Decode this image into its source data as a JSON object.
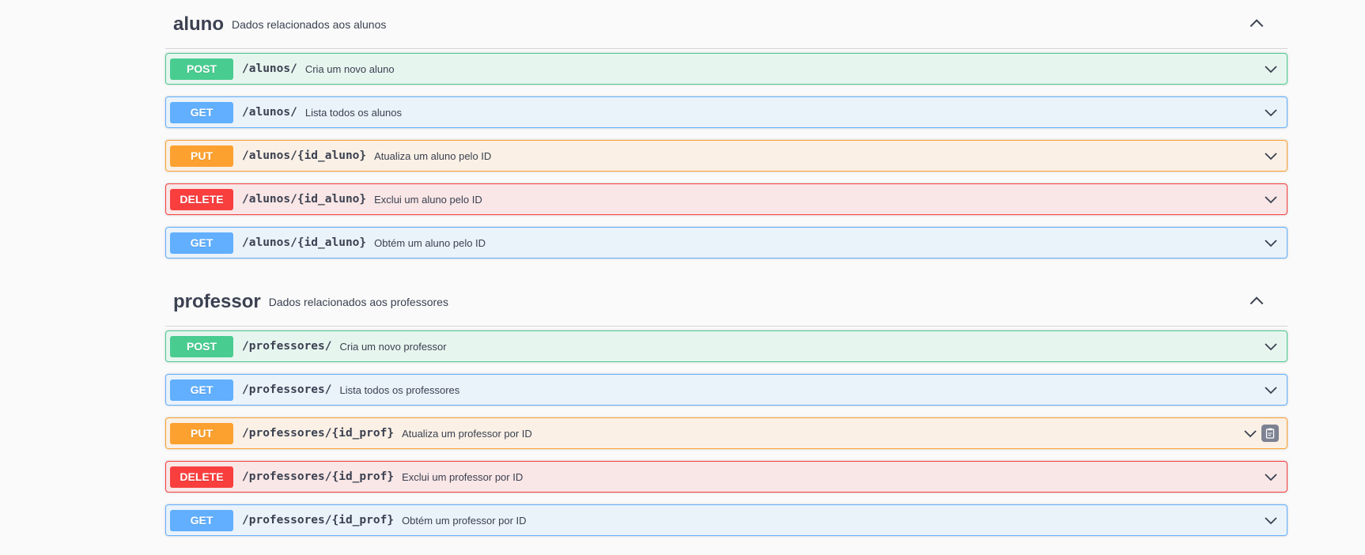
{
  "tags": [
    {
      "name": "aluno",
      "description": "Dados relacionados aos alunos",
      "chevron_icon": "chevron-up-icon",
      "operations": [
        {
          "method": "POST",
          "path": "/alunos/",
          "summary": "Cria um novo aluno"
        },
        {
          "method": "GET",
          "path": "/alunos/",
          "summary": "Lista todos os alunos"
        },
        {
          "method": "PUT",
          "path": "/alunos/{id_aluno}",
          "summary": "Atualiza um aluno pelo ID"
        },
        {
          "method": "DELETE",
          "path": "/alunos/{id_aluno}",
          "summary": "Exclui um aluno pelo ID"
        },
        {
          "method": "GET",
          "path": "/alunos/{id_aluno}",
          "summary": "Obtém um aluno pelo ID"
        }
      ]
    },
    {
      "name": "professor",
      "description": "Dados relacionados aos professores",
      "chevron_icon": "chevron-up-icon",
      "operations": [
        {
          "method": "POST",
          "path": "/professores/",
          "summary": "Cria um novo professor"
        },
        {
          "method": "GET",
          "path": "/professores/",
          "summary": "Lista todos os professores"
        },
        {
          "method": "PUT",
          "path": "/professores/{id_prof}",
          "summary": "Atualiza um professor por ID",
          "copy_icon": "clipboard-icon"
        },
        {
          "method": "DELETE",
          "path": "/professores/{id_prof}",
          "summary": "Exclui um professor por ID"
        },
        {
          "method": "GET",
          "path": "/professores/{id_prof}",
          "summary": "Obtém um professor por ID"
        }
      ]
    }
  ],
  "colors": {
    "post": "#49cc90",
    "get": "#61affe",
    "put": "#fca130",
    "delete": "#f93e3e",
    "text": "#3b4151"
  }
}
